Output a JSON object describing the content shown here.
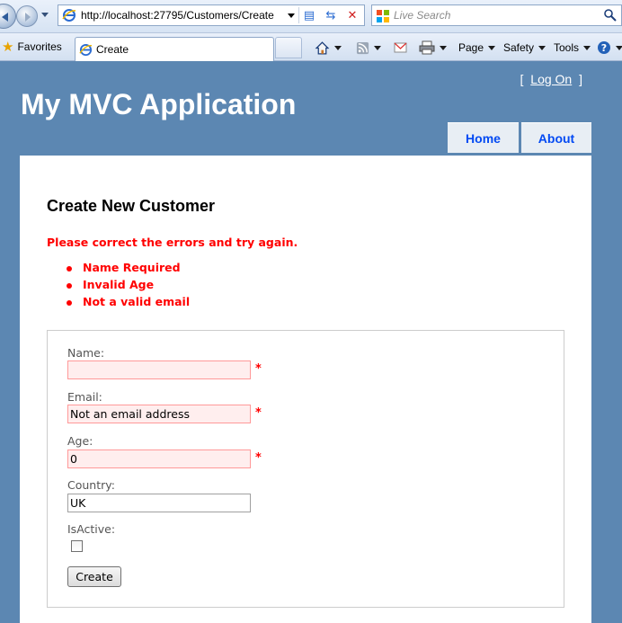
{
  "browser": {
    "url": "http://localhost:27795/Customers/Create",
    "search_placeholder": "Live Search",
    "favorites_label": "Favorites",
    "tab_title": "Create",
    "toolbar": {
      "page_label": "Page",
      "safety_label": "Safety",
      "tools_label": "Tools"
    }
  },
  "site": {
    "title": "My MVC Application",
    "login_open": "[",
    "login_link": "Log On",
    "login_close": "]",
    "menu": [
      {
        "label": "Home"
      },
      {
        "label": "About"
      }
    ]
  },
  "form": {
    "heading": "Create New Customer",
    "error_summary": "Please correct the errors and try again.",
    "errors": [
      "Name Required",
      "Invalid Age",
      "Not a valid email"
    ],
    "fields": {
      "name": {
        "label": "Name:",
        "value": ""
      },
      "email": {
        "label": "Email:",
        "value": "Not an email address"
      },
      "age": {
        "label": "Age:",
        "value": "0"
      },
      "country": {
        "label": "Country:",
        "value": "UK"
      },
      "isactive": {
        "label": "IsActive:",
        "checked": false
      }
    },
    "required_marker": "*",
    "submit_label": "Create"
  },
  "colors": {
    "page_background": "#5c87b2",
    "error_text": "#ff0000",
    "error_field_background": "#ffeeee",
    "menu_text": "#034af3"
  }
}
